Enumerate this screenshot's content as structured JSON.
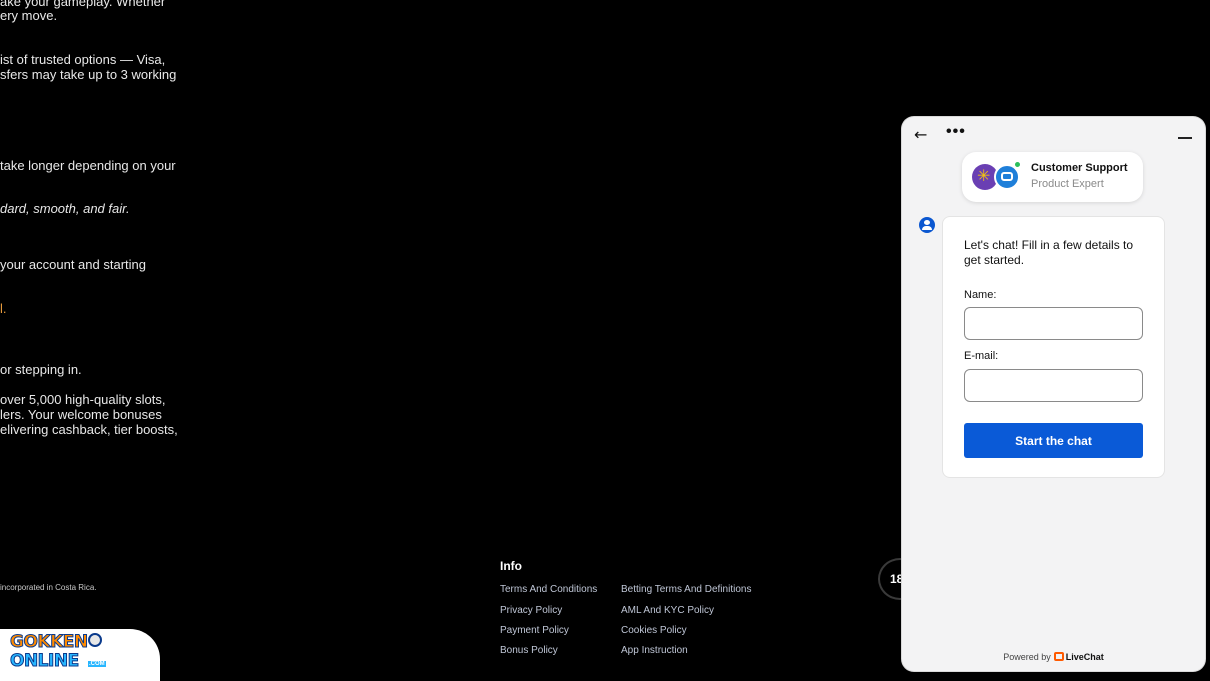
{
  "article": {
    "lines": [
      {
        "text": "ake your gameplay. Whether",
        "style": "normal"
      },
      {
        "text": "ery move.",
        "style": "normal"
      },
      {
        "text": "ist of trusted options — Visa,",
        "style": "normal"
      },
      {
        "text": "sfers may take up to 3 working",
        "style": "normal"
      },
      {
        "text": "take longer depending on your",
        "style": "normal"
      },
      {
        "text": "dard, smooth, and fair.",
        "style": "italic"
      },
      {
        "text": "your account and starting",
        "style": "normal"
      },
      {
        "text": "l.",
        "style": "orange"
      },
      {
        "text": "or stepping in.",
        "style": "normal"
      },
      {
        "text": "over 5,000 high-quality slots,",
        "style": "normal"
      },
      {
        "text": "lers. Your welcome bonuses",
        "style": "normal"
      },
      {
        "text": "elivering cashback, tier boosts,",
        "style": "normal"
      }
    ]
  },
  "footer": {
    "note": "incorporated in Costa Rica.",
    "info_heading": "Info",
    "links_col1": [
      "Terms And Conditions",
      "Privacy Policy",
      "Payment Policy",
      "Bonus Policy"
    ],
    "links_col2": [
      "Betting Terms And Definitions",
      "AML And KYC Policy",
      "Cookies Policy",
      "App Instruction"
    ],
    "age_badge": "18",
    "logo": {
      "line1": "GOKKEN",
      "line2": "ONLINE",
      "suffix": ".COM"
    }
  },
  "chat": {
    "back_icon": "←",
    "more_icon": "•••",
    "agent": {
      "name": "Customer Support",
      "role": "Product Expert",
      "status": "online"
    },
    "intro": "Let's chat! Fill in a few details to get started.",
    "name_label": "Name:",
    "name_value": "",
    "email_label": "E-mail:",
    "email_value": "",
    "start_button": "Start the chat",
    "powered_prefix": "Powered by",
    "powered_brand": "LiveChat"
  },
  "colors": {
    "page_bg": "#000000",
    "chat_accent": "#0a5ad7",
    "livechat_brand": "#ff5a00",
    "online": "#2bbf5c"
  }
}
